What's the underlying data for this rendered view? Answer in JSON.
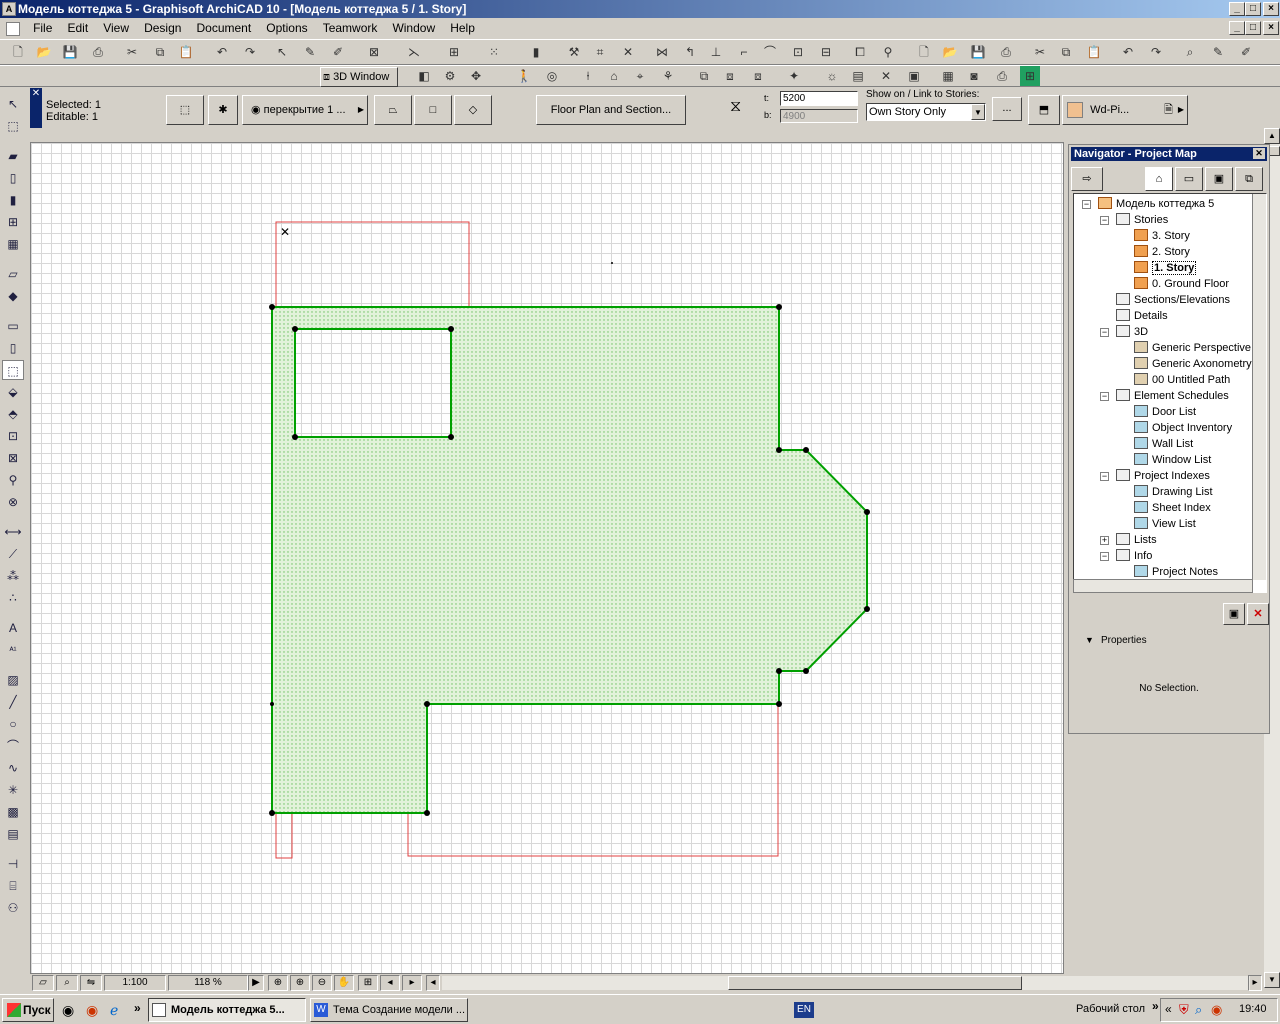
{
  "window": {
    "title": "Модель коттеджа 5 - Graphisoft ArchiCAD 10 - [Модель коттеджа 5 / 1. Story]"
  },
  "menu": [
    "File",
    "Edit",
    "View",
    "Design",
    "Document",
    "Options",
    "Teamwork",
    "Window",
    "Help"
  ],
  "toolbar2": {
    "window_3d_label": "3D Window"
  },
  "infobox": {
    "selected": "Selected: 1",
    "editable": "Editable: 1",
    "layer": "перекрытие 1 ...",
    "floor_plan_section": "Floor Plan and Section...",
    "t_label": "t:",
    "t_value": "5200",
    "b_label": "b:",
    "b_value": "4900",
    "show_on_label": "Show on / Link to Stories:",
    "show_on_value": "Own Story Only",
    "more_button": "...",
    "material": "Wd-Pi..."
  },
  "navigator": {
    "title": "Navigator - Project Map",
    "tree": [
      {
        "label": "Модель коттеджа 5",
        "level": 0,
        "icon": "home",
        "toggle": "−"
      },
      {
        "label": "Stories",
        "level": 1,
        "icon": "folder",
        "toggle": "−"
      },
      {
        "label": "3. Story",
        "level": 2,
        "icon": "story"
      },
      {
        "label": "2. Story",
        "level": 2,
        "icon": "story"
      },
      {
        "label": "1. Story",
        "level": 2,
        "icon": "story",
        "selected": true
      },
      {
        "label": "0. Ground Floor",
        "level": 2,
        "icon": "story"
      },
      {
        "label": "Sections/Elevations",
        "level": 1,
        "icon": "folder"
      },
      {
        "label": "Details",
        "level": 1,
        "icon": "folder"
      },
      {
        "label": "3D",
        "level": 1,
        "icon": "folder",
        "toggle": "−"
      },
      {
        "label": "Generic Perspective",
        "level": 2,
        "icon": "view3d"
      },
      {
        "label": "Generic Axonometry",
        "level": 2,
        "icon": "view3d"
      },
      {
        "label": "00 Untitled Path",
        "level": 2,
        "icon": "view3d"
      },
      {
        "label": "Element Schedules",
        "level": 1,
        "icon": "folder",
        "toggle": "−"
      },
      {
        "label": "Door List",
        "level": 2,
        "icon": "sched"
      },
      {
        "label": "Object Inventory",
        "level": 2,
        "icon": "sched"
      },
      {
        "label": "Wall List",
        "level": 2,
        "icon": "sched"
      },
      {
        "label": "Window List",
        "level": 2,
        "icon": "sched"
      },
      {
        "label": "Project Indexes",
        "level": 1,
        "icon": "folder",
        "toggle": "−"
      },
      {
        "label": "Drawing List",
        "level": 2,
        "icon": "sched"
      },
      {
        "label": "Sheet Index",
        "level": 2,
        "icon": "sched"
      },
      {
        "label": "View List",
        "level": 2,
        "icon": "sched"
      },
      {
        "label": "Lists",
        "level": 1,
        "icon": "folder",
        "toggle": "+"
      },
      {
        "label": "Info",
        "level": 1,
        "icon": "folder",
        "toggle": "−"
      },
      {
        "label": "Project Notes",
        "level": 2,
        "icon": "sched"
      }
    ],
    "properties_label": "Properties",
    "no_selection": "No Selection."
  },
  "statusbar": {
    "scale": "1:100",
    "zoom": "118 %"
  },
  "taskbar": {
    "start": "Пуск",
    "task1": "Модель коттеджа 5...",
    "task2": "Тема Создание модели ...",
    "lang": "EN",
    "desktop": "Рабочий стол",
    "clock": "19:40"
  },
  "colors": {
    "slab_outline": "#00a000",
    "slab_fill": "#d8f0d0",
    "wall_outline": "#e04040"
  }
}
